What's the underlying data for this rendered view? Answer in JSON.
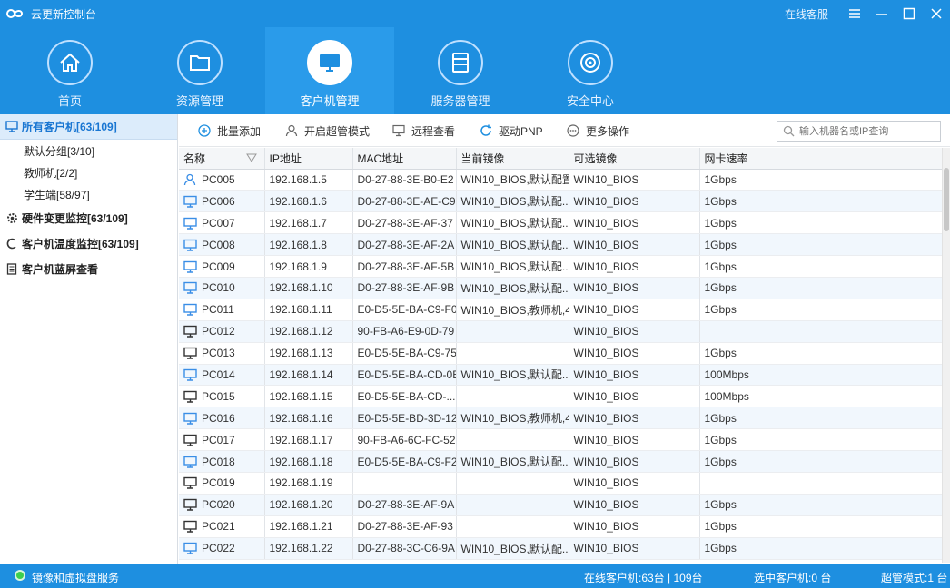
{
  "app": {
    "title": "云更新控制台",
    "service_link": "在线客服"
  },
  "nav": [
    {
      "label": "首页",
      "icon": "home-icon"
    },
    {
      "label": "资源管理",
      "icon": "folder-icon"
    },
    {
      "label": "客户机管理",
      "icon": "monitor-icon",
      "active": true
    },
    {
      "label": "服务器管理",
      "icon": "server-icon"
    },
    {
      "label": "安全中心",
      "icon": "shield-target-icon"
    }
  ],
  "sidebar": {
    "all_clients": "所有客户机[63/109]",
    "groups": [
      "默认分组[3/10]",
      "教师机[2/2]",
      "学生端[58/97]"
    ],
    "hardware": "硬件变更监控[63/109]",
    "temperature": "客户机温度监控[63/109]",
    "bluescreen": "客户机蓝屏查看"
  },
  "toolbar": {
    "batch_add": "批量添加",
    "super_mode": "开启超管模式",
    "remote_view": "远程查看",
    "driver_pnp": "驱动PNP",
    "more_ops": "更多操作",
    "search_placeholder": "输入机器名或IP查询"
  },
  "table": {
    "columns": [
      "名称",
      "IP地址",
      "MAC地址",
      "当前镜像",
      "可选镜像",
      "网卡速率"
    ],
    "rows": [
      {
        "name": "PC005",
        "ip": "192.168.1.5",
        "mac": "D0-27-88-3E-B0-E2",
        "current": "WIN10_BIOS,默认配置",
        "optional": "WIN10_BIOS",
        "nic": "1Gbps",
        "icon": "user"
      },
      {
        "name": "PC006",
        "ip": "192.168.1.6",
        "mac": "D0-27-88-3E-AE-C9",
        "current": "WIN10_BIOS,默认配...",
        "optional": "WIN10_BIOS",
        "nic": "1Gbps",
        "icon": "blue"
      },
      {
        "name": "PC007",
        "ip": "192.168.1.7",
        "mac": "D0-27-88-3E-AF-37",
        "current": "WIN10_BIOS,默认配...",
        "optional": "WIN10_BIOS",
        "nic": "1Gbps",
        "icon": "blue"
      },
      {
        "name": "PC008",
        "ip": "192.168.1.8",
        "mac": "D0-27-88-3E-AF-2A",
        "current": "WIN10_BIOS,默认配...",
        "optional": "WIN10_BIOS",
        "nic": "1Gbps",
        "icon": "blue"
      },
      {
        "name": "PC009",
        "ip": "192.168.1.9",
        "mac": "D0-27-88-3E-AF-5B",
        "current": "WIN10_BIOS,默认配...",
        "optional": "WIN10_BIOS",
        "nic": "1Gbps",
        "icon": "blue"
      },
      {
        "name": "PC010",
        "ip": "192.168.1.10",
        "mac": "D0-27-88-3E-AF-9B",
        "current": "WIN10_BIOS,默认配...",
        "optional": "WIN10_BIOS",
        "nic": "1Gbps",
        "icon": "blue"
      },
      {
        "name": "PC011",
        "ip": "192.168.1.11",
        "mac": "E0-D5-5E-BA-C9-F0",
        "current": "WIN10_BIOS,教师机,4",
        "optional": "WIN10_BIOS",
        "nic": "1Gbps",
        "icon": "blue"
      },
      {
        "name": "PC012",
        "ip": "192.168.1.12",
        "mac": "90-FB-A6-E9-0D-79",
        "current": "",
        "optional": "WIN10_BIOS",
        "nic": "",
        "icon": "dark"
      },
      {
        "name": "PC013",
        "ip": "192.168.1.13",
        "mac": "E0-D5-5E-BA-C9-75",
        "current": "",
        "optional": "WIN10_BIOS",
        "nic": "1Gbps",
        "icon": "dark"
      },
      {
        "name": "PC014",
        "ip": "192.168.1.14",
        "mac": "E0-D5-5E-BA-CD-0E",
        "current": "WIN10_BIOS,默认配...",
        "optional": "WIN10_BIOS",
        "nic": "100Mbps",
        "icon": "blue"
      },
      {
        "name": "PC015",
        "ip": "192.168.1.15",
        "mac": "E0-D5-5E-BA-CD-...",
        "current": "",
        "optional": "WIN10_BIOS",
        "nic": "100Mbps",
        "icon": "dark"
      },
      {
        "name": "PC016",
        "ip": "192.168.1.16",
        "mac": "E0-D5-5E-BD-3D-12",
        "current": "WIN10_BIOS,教师机,4",
        "optional": "WIN10_BIOS",
        "nic": "1Gbps",
        "icon": "blue"
      },
      {
        "name": "PC017",
        "ip": "192.168.1.17",
        "mac": "90-FB-A6-6C-FC-52",
        "current": "",
        "optional": "WIN10_BIOS",
        "nic": "1Gbps",
        "icon": "dark"
      },
      {
        "name": "PC018",
        "ip": "192.168.1.18",
        "mac": "E0-D5-5E-BA-C9-F2",
        "current": "WIN10_BIOS,默认配...",
        "optional": "WIN10_BIOS",
        "nic": "1Gbps",
        "icon": "blue"
      },
      {
        "name": "PC019",
        "ip": "192.168.1.19",
        "mac": "",
        "current": "",
        "optional": "WIN10_BIOS",
        "nic": "",
        "icon": "dark"
      },
      {
        "name": "PC020",
        "ip": "192.168.1.20",
        "mac": "D0-27-88-3E-AF-9A",
        "current": "",
        "optional": "WIN10_BIOS",
        "nic": "1Gbps",
        "icon": "dark"
      },
      {
        "name": "PC021",
        "ip": "192.168.1.21",
        "mac": "D0-27-88-3E-AF-93",
        "current": "",
        "optional": "WIN10_BIOS",
        "nic": "1Gbps",
        "icon": "dark"
      },
      {
        "name": "PC022",
        "ip": "192.168.1.22",
        "mac": "D0-27-88-3C-C6-9A",
        "current": "WIN10_BIOS,默认配...",
        "optional": "WIN10_BIOS",
        "nic": "1Gbps",
        "icon": "blue"
      }
    ]
  },
  "status": {
    "service": "镜像和虚拟盘服务",
    "online": "在线客户机:63台 | 109台",
    "selected": "选中客户机:0 台",
    "super_mode": "超管模式:1 台"
  },
  "colors": {
    "brand": "#1e8fe0",
    "row_alt": "#f1f7fd",
    "online_dot": "#3ccf4e"
  }
}
